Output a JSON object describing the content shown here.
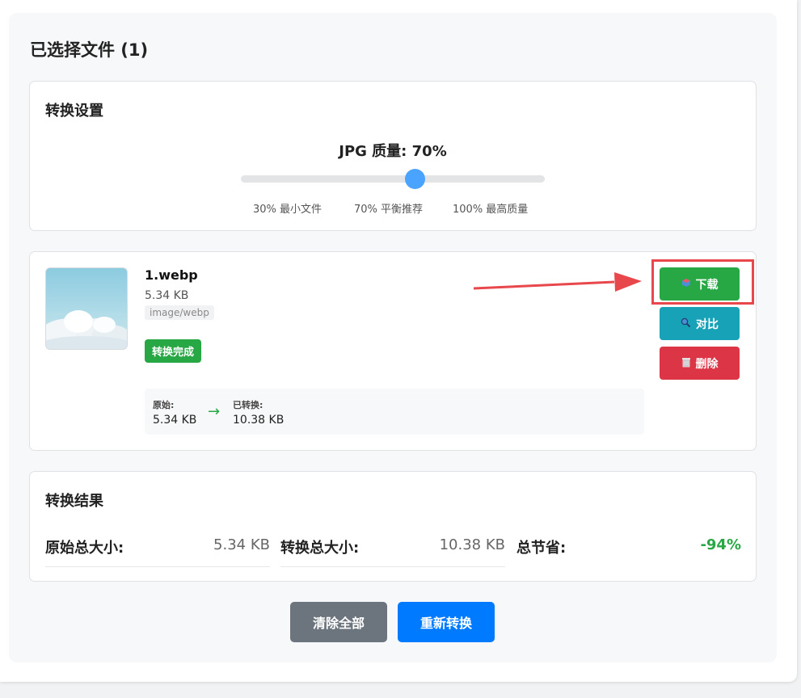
{
  "page": {
    "title": "已选择文件 (1)"
  },
  "settings": {
    "title": "转换设置",
    "quality_label": "JPG 质量: 70%",
    "quality_value": 70,
    "quality_min": 30,
    "quality_max": 100,
    "marks": [
      "30% 最小文件",
      "70% 平衡推荐",
      "100% 最高质量"
    ]
  },
  "file": {
    "name": "1.webp",
    "size": "5.34 KB",
    "type": "image/webp",
    "status": "转换完成",
    "original_label": "原始:",
    "original_size": "5.34 KB",
    "converted_label": "已转换:",
    "converted_size": "10.38 KB",
    "arrow": "→"
  },
  "actions": {
    "download_label": "下载",
    "compare_label": "对比",
    "delete_label": "删除"
  },
  "results": {
    "title": "转换结果",
    "original_total_label": "原始总大小:",
    "original_total_value": "5.34 KB",
    "converted_total_label": "转换总大小:",
    "converted_total_value": "10.38 KB",
    "savings_label": "总节省:",
    "savings_value": "-94%"
  },
  "footer": {
    "clear_label": "清除全部",
    "reconvert_label": "重新转换"
  },
  "colors": {
    "success": "#28a745",
    "info": "#17a2b8",
    "danger": "#dc3545",
    "primary": "#007bff",
    "secondary": "#6c757d",
    "annotation": "#e8474b"
  }
}
